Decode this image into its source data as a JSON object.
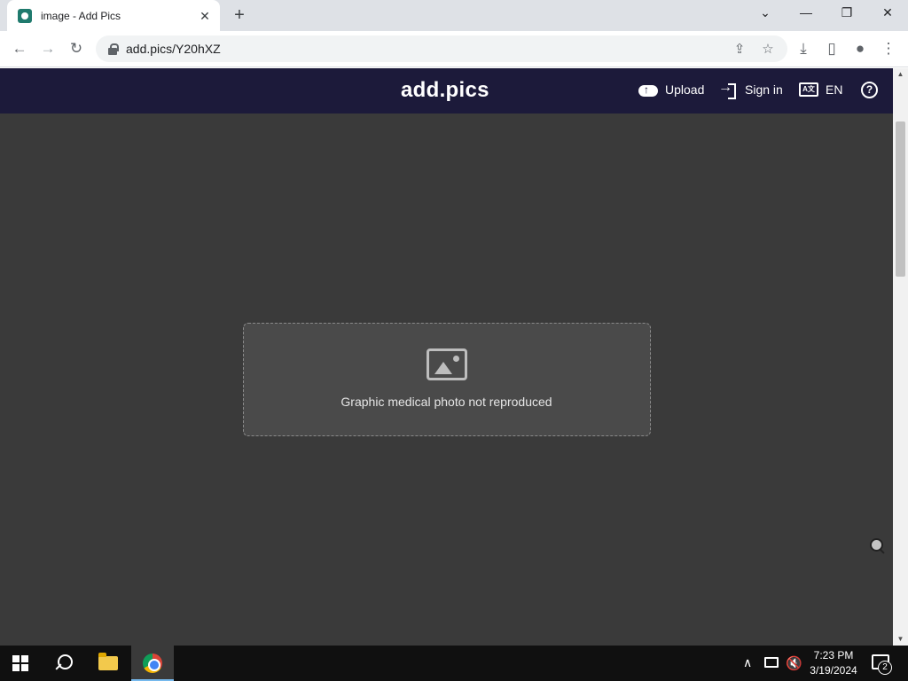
{
  "browser": {
    "tab_title": "image - Add Pics",
    "tab_close": "✕",
    "new_tab": "+",
    "url": "add.pics/Y20hXZ",
    "window_controls": {
      "minimize": "—",
      "restore": "❐",
      "close": "✕",
      "tab_search": "⌄"
    },
    "nav": {
      "back": "←",
      "forward": "→",
      "reload": "↻"
    },
    "omnibox_icons": {
      "share": "⇪",
      "bookmark": "☆"
    },
    "toolbar_icons": {
      "download": "⤓",
      "side_panel": "▯",
      "profile": "●",
      "menu": "⋮"
    }
  },
  "site": {
    "logo": "add.pics",
    "upload_label": "Upload",
    "signin_label": "Sign in",
    "lang_icon_text": "A文",
    "lang_label": "EN",
    "help": "?"
  },
  "viewer": {
    "placeholder_text": "Graphic medical photo not reproduced"
  },
  "scrollbar": {
    "up": "▲",
    "down": "▼"
  },
  "taskbar": {
    "tray_chevron": "∧",
    "volume": "🔇",
    "time": "7:23 PM",
    "date": "3/19/2024",
    "notification_count": "2"
  }
}
